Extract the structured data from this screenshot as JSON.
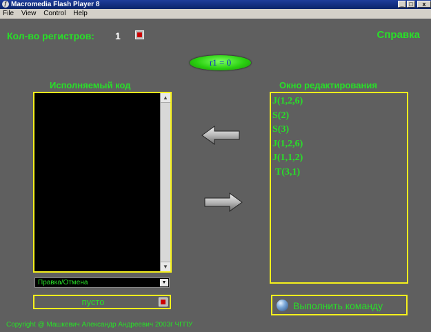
{
  "window": {
    "title": "Macromedia Flash Player 8",
    "minimize_label": "_",
    "maximize_label": "□",
    "close_label": "x"
  },
  "menu": {
    "items": [
      "File",
      "View",
      "Control",
      "Help"
    ]
  },
  "app": {
    "registers_label": "Кол-во регистров:",
    "registers_count": "1",
    "help_label": "Справка",
    "register_display": "r1 = 0",
    "exec_code_title": "Исполняемый код",
    "edit_window_title": "Окно редактирования",
    "code_lines": [
      "J(1,2,6)",
      "S(2)",
      "S(3)",
      "J(1,2,6)",
      "J(1,1,2)",
      "T(3,1)"
    ],
    "dropdown_value": "Правка/Отмена",
    "empty_label": "пусто",
    "execute_label": "Выполнить команду",
    "copyright": "Copyright @ Машкевич Александр Андреевич 2003г ЧГПУ"
  },
  "colors": {
    "accent_green": "#28e028",
    "frame_yellow": "#f6f11c",
    "background": "#5f5f5f"
  }
}
